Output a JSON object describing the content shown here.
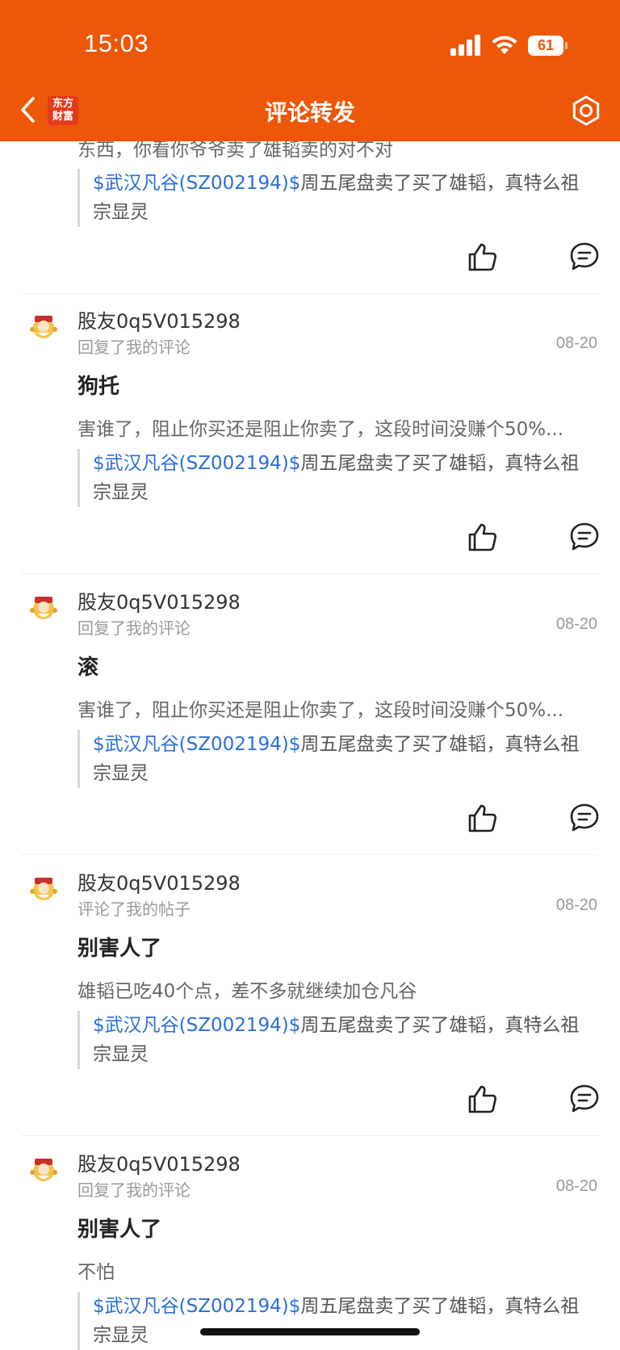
{
  "status": {
    "time": "15:03",
    "battery": "61"
  },
  "header": {
    "title": "评论转发",
    "logo_line1": "东方",
    "logo_line2": "财富"
  },
  "colors": {
    "brand": "#ED5708",
    "stock_link": "#2A6FD6"
  },
  "quote": {
    "stock": "$武汉凡谷(SZ002194)$",
    "text": "周五尾盘卖了买了雄韬，真特么祖宗显灵"
  },
  "partial_top": {
    "excerpt": "东西，你看你爷爷卖了雄韬卖的对不对"
  },
  "items": [
    {
      "user": "股友0q5V015298",
      "action": "回复了我的评论",
      "date": "08-20",
      "title": "狗托",
      "excerpt": "害谁了，阻止你买还是阻止你卖了，这段时间没赚个50%..."
    },
    {
      "user": "股友0q5V015298",
      "action": "回复了我的评论",
      "date": "08-20",
      "title": "滚",
      "excerpt": "害谁了，阻止你买还是阻止你卖了，这段时间没赚个50%..."
    },
    {
      "user": "股友0q5V015298",
      "action": "评论了我的帖子",
      "date": "08-20",
      "title": "别害人了",
      "excerpt": "雄韬已吃40个点，差不多就继续加仓凡谷"
    },
    {
      "user": "股友0q5V015298",
      "action": "回复了我的评论",
      "date": "08-20",
      "title": "别害人了",
      "excerpt": "不怕"
    }
  ]
}
